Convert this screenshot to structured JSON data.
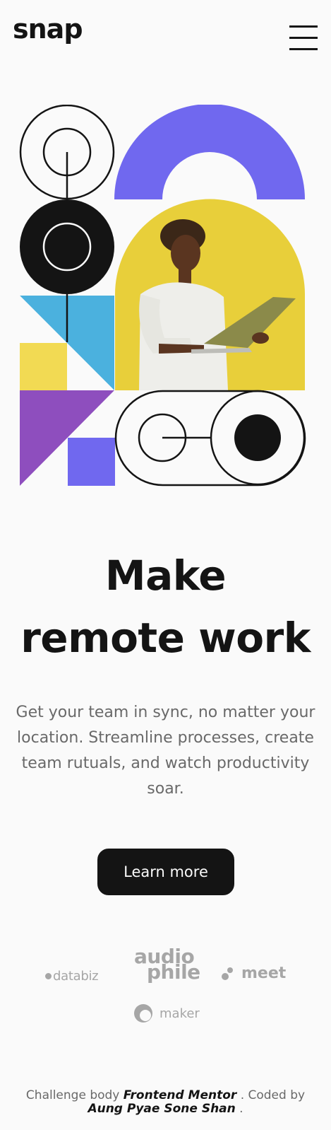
{
  "header": {
    "logo": "snap",
    "menu_icon": "hamburger-menu-icon"
  },
  "hero": {
    "illustration": "geometric-shapes-with-man-holding-laptop",
    "colors": {
      "purple": "#7068ef",
      "blue": "#4bb1de",
      "yellow": "#f2da53",
      "violet": "#8e4ebe",
      "ink": "#141414"
    },
    "title_line1": "Make",
    "title_line2": "remote work",
    "description": "Get your team in sync, no matter your location. Streamline processes, create team rutuals, and watch productivity soar.",
    "cta_label": "Learn more"
  },
  "clients": {
    "databiz": "databiz",
    "audiophile_line1": "audio",
    "audiophile_line2": "phile",
    "meet": "meet",
    "maker": "maker"
  },
  "footer": {
    "prefix": "Challenge body",
    "mentor": "Frontend Mentor",
    "coded_by": ". Coded by",
    "author": "Aung Pyae Sone Shan",
    "suffix": "."
  }
}
